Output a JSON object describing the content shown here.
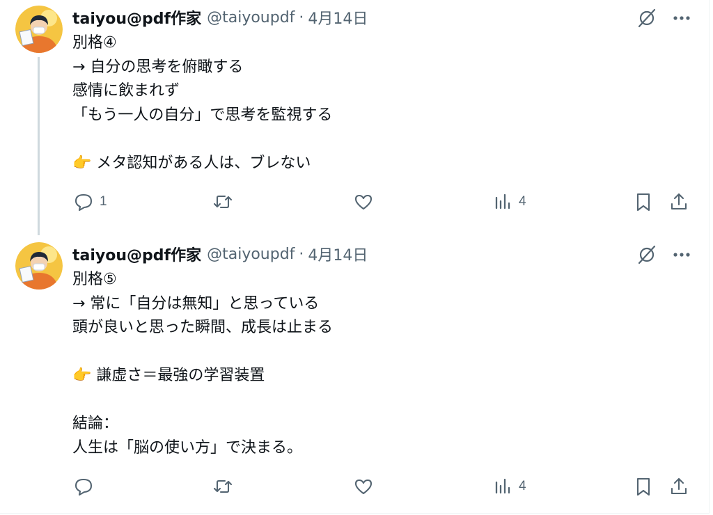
{
  "tweets": [
    {
      "author": {
        "name": "taiyou@pdf作家",
        "handle": "@taiyoupdf",
        "separator": "·",
        "date": "4月14日"
      },
      "lines": [
        "別格④",
        "→ 自分の思考を俯瞰する",
        "感情に飲まれず",
        "「もう一人の自分」で思考を監視する",
        "",
        "👉 メタ認知がある人は、ブレない"
      ],
      "stats": {
        "replies": "1",
        "retweets": "",
        "likes": "",
        "views": "4"
      }
    },
    {
      "author": {
        "name": "taiyou@pdf作家",
        "handle": "@taiyoupdf",
        "separator": "·",
        "date": "4月14日"
      },
      "lines": [
        "別格⑤",
        "→ 常に「自分は無知」と思っている",
        "頭が良いと思った瞬間、成長は止まる",
        "",
        "👉 謙虚さ＝最強の学習装置",
        "",
        "結論：",
        "人生は「脳の使い方」で決まる。"
      ],
      "stats": {
        "replies": "",
        "retweets": "",
        "likes": "",
        "views": "4"
      }
    }
  ],
  "icons": {
    "reply": "reply-icon",
    "retweet": "retweet-icon",
    "like": "heart-icon",
    "views": "views-chart-icon",
    "bookmark": "bookmark-icon",
    "share": "share-icon",
    "grok": "grok-icon",
    "more": "more-icon"
  },
  "colors": {
    "text": "#0f1419",
    "secondary": "#536471",
    "thread_line": "#cfd9de",
    "avatar_hoodie": "#e8772e"
  }
}
